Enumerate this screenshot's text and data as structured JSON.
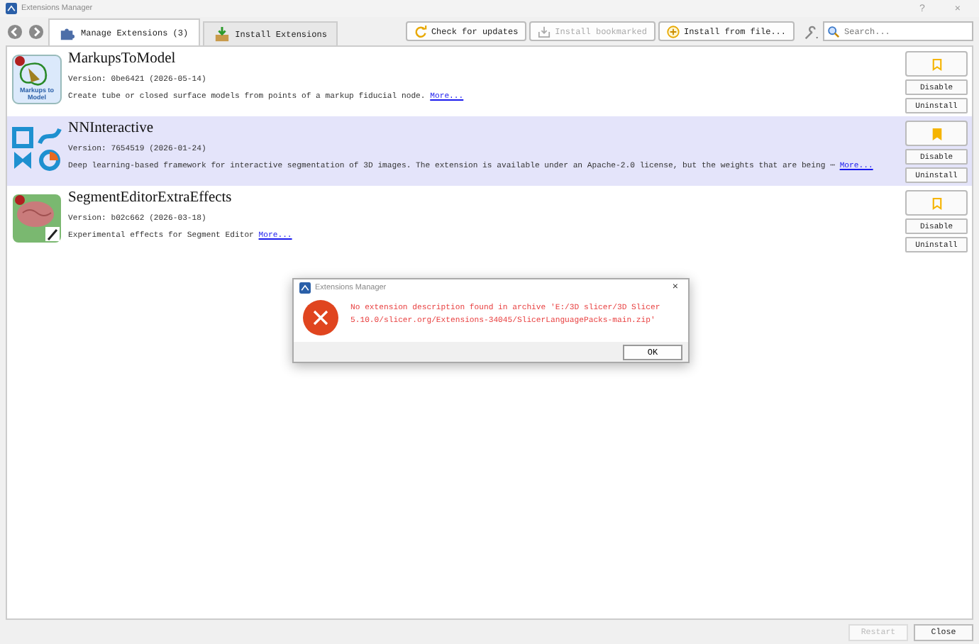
{
  "window": {
    "title": "Extensions Manager",
    "help": "?",
    "close": "×"
  },
  "tabs": [
    {
      "label": "Manage Extensions (3)",
      "selected": true,
      "kind": "puzzle"
    },
    {
      "label": "Install Extensions",
      "selected": false,
      "kind": "box"
    }
  ],
  "toolbar": {
    "check_updates": "Check for updates",
    "install_bookmarked": {
      "label": "Install bookmarked",
      "disabled": true
    },
    "install_from_file": "Install from file...",
    "search": {
      "placeholder": "Search..."
    }
  },
  "extensions": [
    {
      "name": "MarkupsToModel",
      "version": "Version: 0be6421 (2026-05-14)",
      "description": "Create tube or closed surface models from points of a markup fiducial node.",
      "more": "More...",
      "kind": "markups",
      "icon_label": "Markups to Model",
      "selected": false,
      "bookmarked": false,
      "disable": "Disable",
      "uninstall": "Uninstall"
    },
    {
      "name": "NNInteractive",
      "version": "Version: 7654519 (2026-01-24)",
      "description": "Deep learning-based framework for interactive segmentation of 3D images. The extension is available under an Apache-2.0 license, but the weights that are being ⋯",
      "more": "More...",
      "kind": "nn",
      "selected": true,
      "bookmarked": true,
      "disable": "Disable",
      "uninstall": "Uninstall"
    },
    {
      "name": "SegmentEditorExtraEffects",
      "version": "Version: b02c662 (2026-03-18)",
      "description": "Experimental effects for Segment Editor",
      "more": "More...",
      "kind": "brain",
      "selected": false,
      "bookmarked": false,
      "disable": "Disable",
      "uninstall": "Uninstall"
    }
  ],
  "dialog": {
    "title": "Extensions Manager",
    "close": "×",
    "message": "No extension description found in archive 'E:/3D slicer/3D Slicer 5.10.0/slicer.org/Extensions-34045/SlicerLanguagePacks-main.zip'",
    "ok": "OK"
  },
  "footer": {
    "restart": {
      "label": "Restart",
      "disabled": true
    },
    "close": "Close"
  }
}
